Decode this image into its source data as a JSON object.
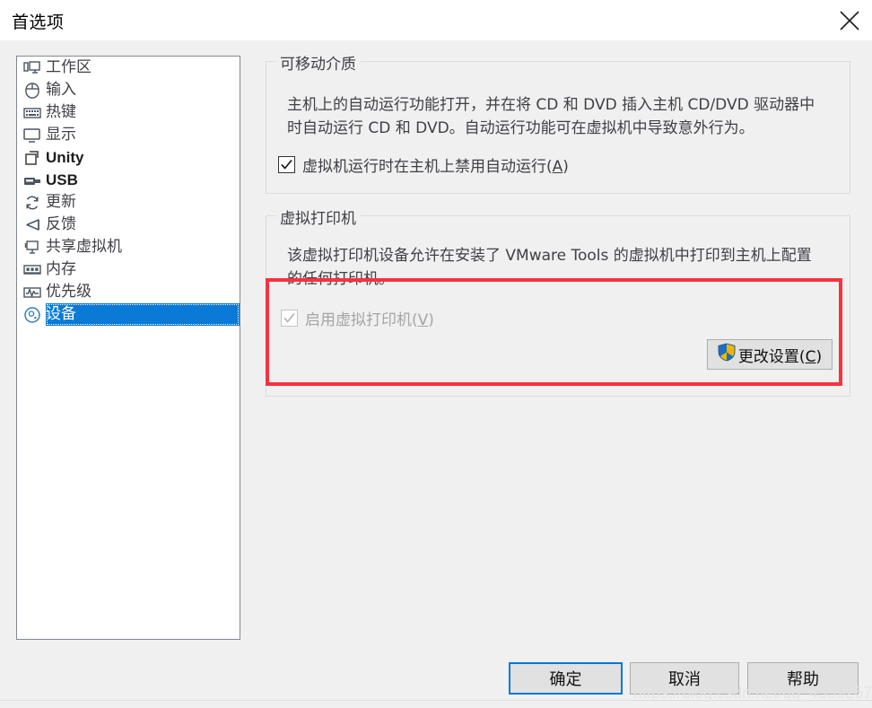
{
  "window": {
    "title": "首选项",
    "close_icon": "close-icon"
  },
  "sidebar": {
    "items": [
      {
        "label": "工作区",
        "icon": "workspace-icon",
        "selected": false
      },
      {
        "label": "输入",
        "icon": "mouse-icon",
        "selected": false
      },
      {
        "label": "热键",
        "icon": "keyboard-icon",
        "selected": false
      },
      {
        "label": "显示",
        "icon": "display-monitor-icon",
        "selected": false
      },
      {
        "label": "Unity",
        "icon": "windows-overlap-icon",
        "selected": false
      },
      {
        "label": "USB",
        "icon": "usb-drive-icon",
        "selected": false
      },
      {
        "label": "更新",
        "icon": "refresh-icon",
        "selected": false
      },
      {
        "label": "反馈",
        "icon": "megaphone-icon",
        "selected": false
      },
      {
        "label": "共享虚拟机",
        "icon": "shared-vm-icon",
        "selected": false
      },
      {
        "label": "内存",
        "icon": "memory-module-icon",
        "selected": false
      },
      {
        "label": "优先级",
        "icon": "waveform-icon",
        "selected": false
      },
      {
        "label": "设备",
        "icon": "disc-device-icon",
        "selected": true
      }
    ]
  },
  "main": {
    "removable_media": {
      "legend": "可移动介质",
      "description_line1": "主机上的自动运行功能打开，并在将 CD 和 DVD 插入主机 CD/DVD 驱动器中",
      "description_line2": "时自动运行 CD 和 DVD。自动运行功能可在虚拟机中导致意外行为。",
      "checkbox": {
        "label_before": "虚拟机运行时在主机上禁用自动运行(",
        "accel": "A",
        "label_after": ")",
        "checked": true,
        "disabled": false
      }
    },
    "virtual_printer": {
      "legend": "虚拟打印机",
      "description_line1": "该虚拟打印机设备允许在安装了 VMware Tools 的虚拟机中打印到主机上配置",
      "description_line2": "的任何打印机。",
      "checkbox": {
        "label_before": "启用虚拟打印机(",
        "accel": "V",
        "label_after": ")",
        "checked": true,
        "disabled": true
      },
      "change_settings_button": {
        "label_before": "更改设置(",
        "accel": "C",
        "label_after": ")",
        "icon": "uac-shield-icon"
      }
    },
    "annotation": {
      "shape": "red-rectangle",
      "color": "#f5333f"
    }
  },
  "footer": {
    "ok_label": "确定",
    "cancel_label": "取消",
    "help_label": "帮助"
  },
  "watermark": {
    "text": "https://blog.csdn.net/qq_43592674"
  }
}
